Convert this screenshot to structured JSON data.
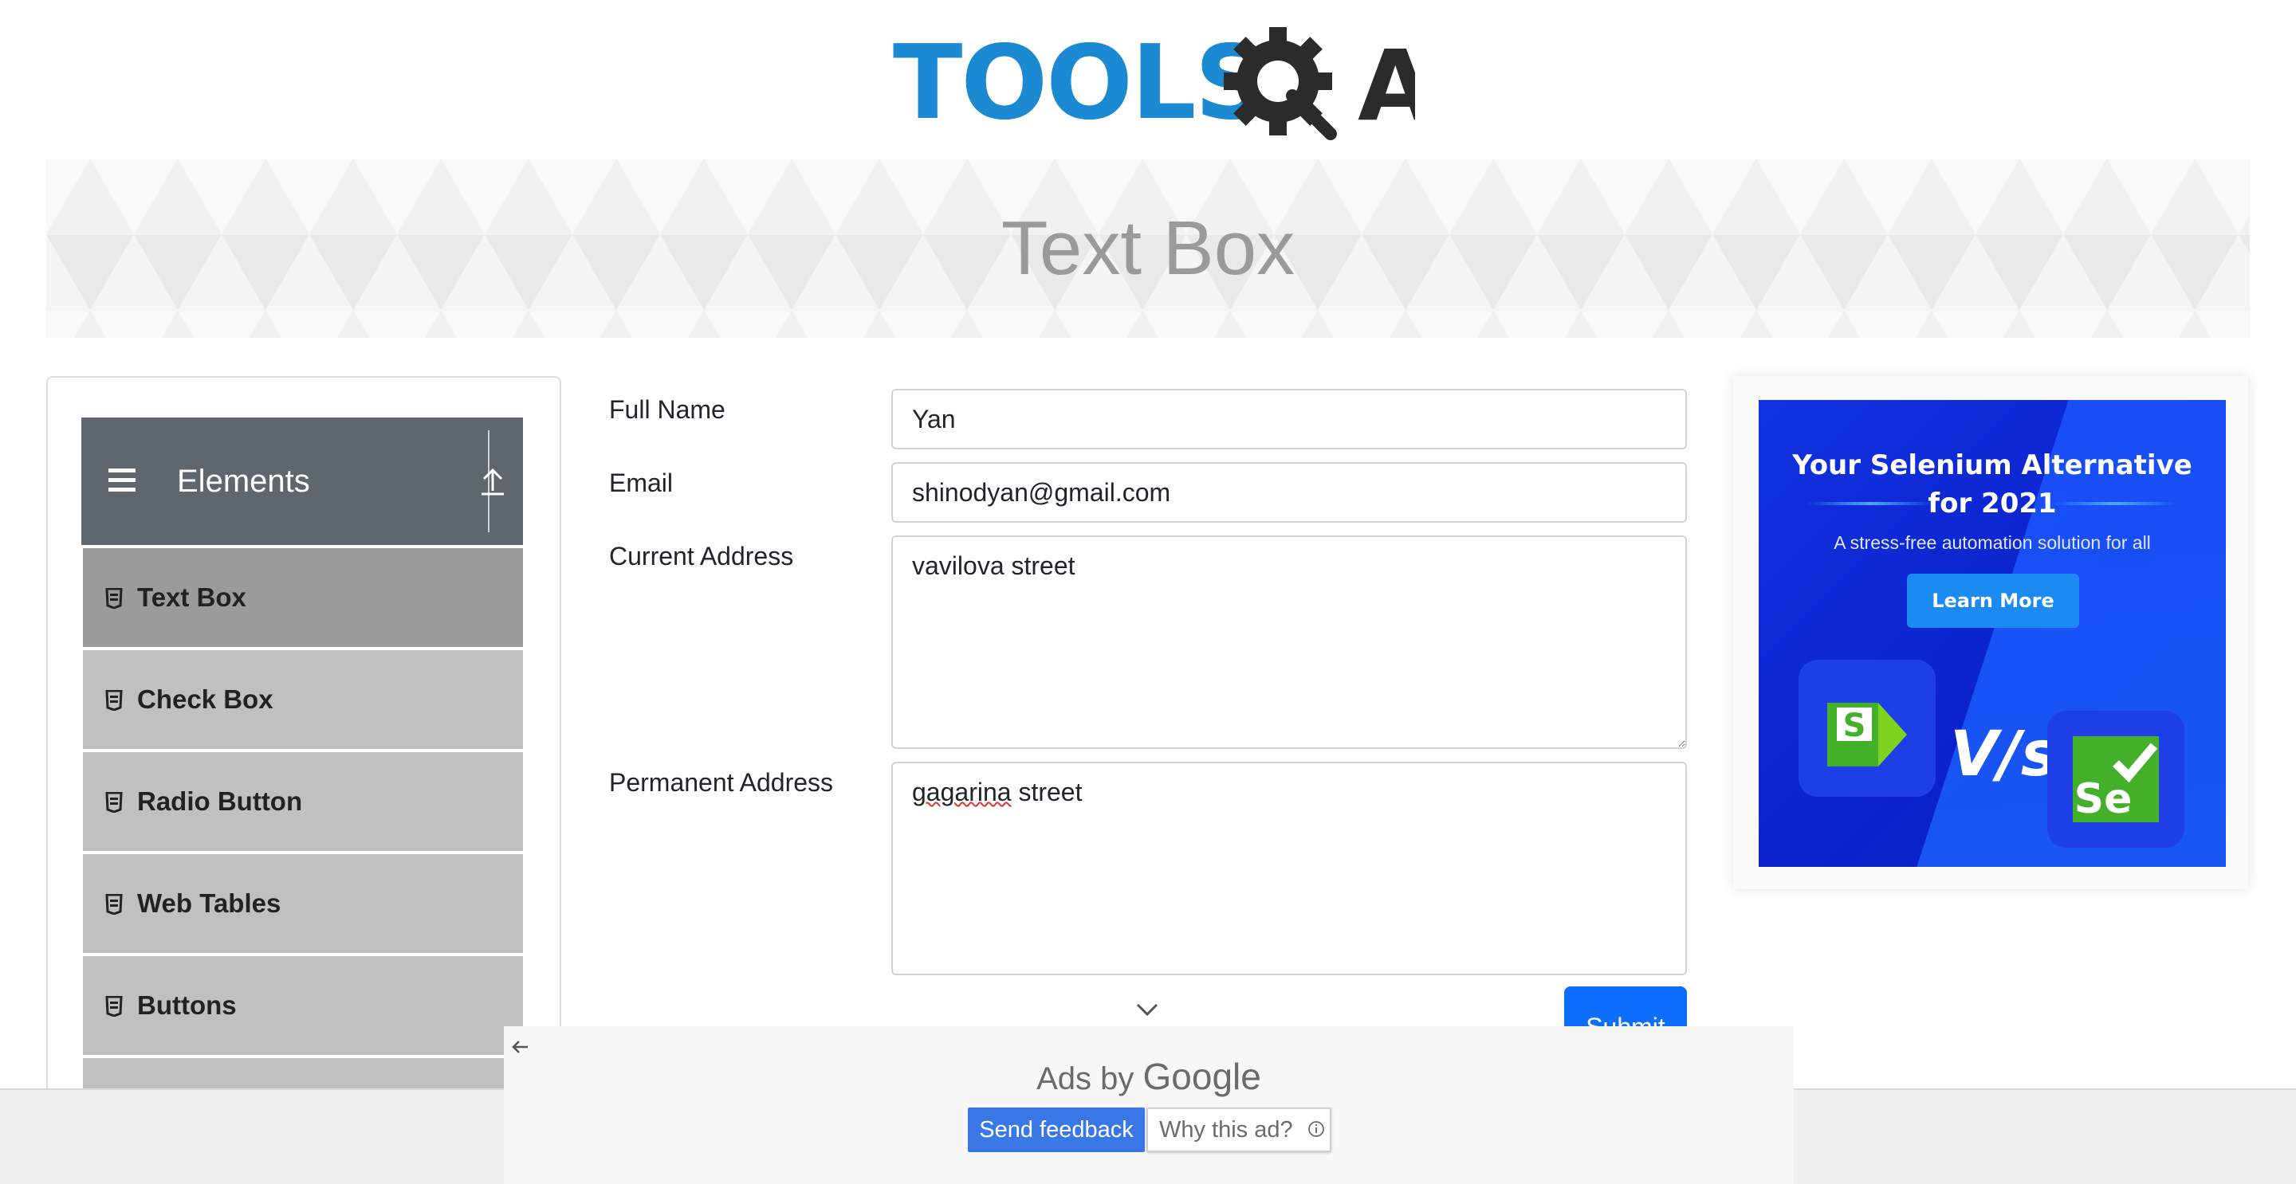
{
  "logo": {
    "text": "TOOLS",
    "mark_letter": "A"
  },
  "banner": {
    "title": "Text Box"
  },
  "sidebar": {
    "group_title": "Elements",
    "items": [
      {
        "label": "Text Box",
        "active": true
      },
      {
        "label": "Check Box"
      },
      {
        "label": "Radio Button"
      },
      {
        "label": "Web Tables"
      },
      {
        "label": "Buttons"
      }
    ]
  },
  "form": {
    "full_name_label": "Full Name",
    "full_name_value": "Yan",
    "email_label": "Email",
    "email_value": "shinodyan@gmail.com",
    "current_address_label": "Current Address",
    "current_address_value": "vavilova street",
    "permanent_address_label": "Permanent Address",
    "permanent_address_word1": "gagarina",
    "permanent_address_word2": " street",
    "submit_label": "Submit"
  },
  "ad": {
    "title_line1": "Your Selenium Alternative",
    "title_line2": "for 2021",
    "subtitle": "A stress-free automation solution for all",
    "cta": "Learn More",
    "vs": "V/s",
    "left_logo_letter": "S",
    "right_logo_letters": "Se"
  },
  "ads_overlay": {
    "ads_by": "Ads by",
    "google": "Google",
    "send_feedback": "Send feedback",
    "why_this_ad": "Why this ad?"
  },
  "colors": {
    "brand_blue": "#1b8ad3",
    "sidebar_header": "#5f666d",
    "active_item": "#9b9b9b",
    "item_bg": "#c0c0c0",
    "primary_button": "#0d6efd",
    "ad_green": "#43b02a"
  },
  "icons": [
    "gear-magnifier-icon",
    "hamburger-icon",
    "collapse-arrow-icon",
    "document-icon",
    "chevron-down-icon",
    "back-arrow-icon",
    "info-icon"
  ]
}
